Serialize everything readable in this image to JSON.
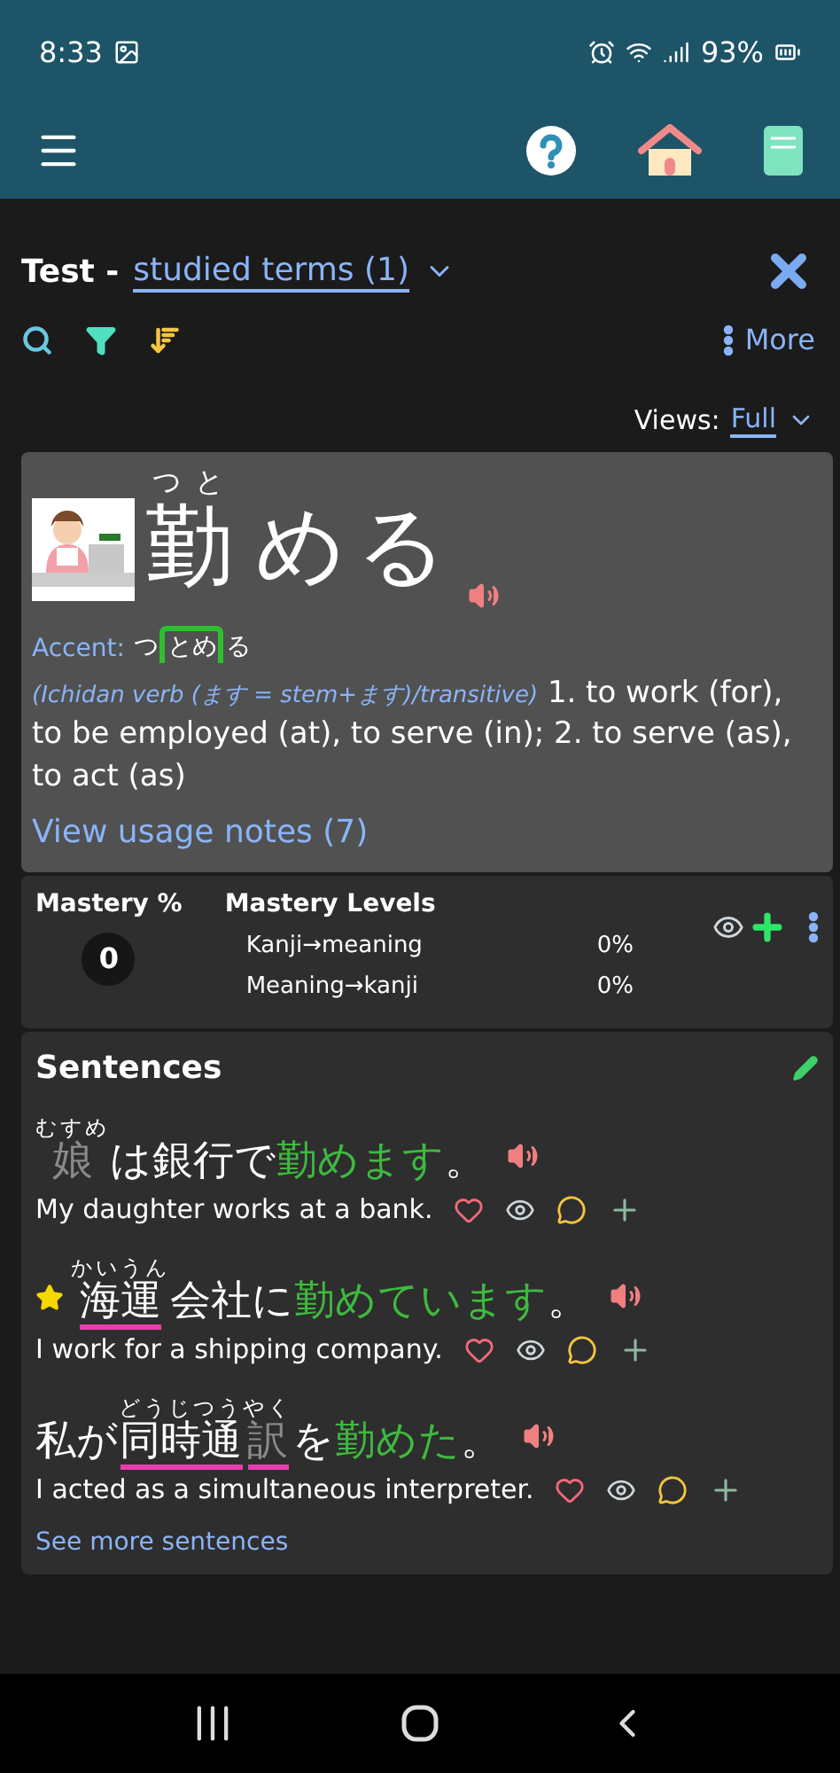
{
  "status_bar": {
    "time": "8:33",
    "battery": "93%"
  },
  "header": {
    "title": "Test -",
    "set": "studied terms (1)",
    "more": "More",
    "views_label": "Views:",
    "views_value": "Full"
  },
  "term": {
    "headword": [
      {
        "text": "勤",
        "ruby": "つと"
      },
      {
        "text": "める"
      }
    ],
    "accent_label": "Accent:",
    "accent": [
      {
        "text": "つ",
        "high": false
      },
      {
        "text": "とめ",
        "high": true
      },
      {
        "text": "る",
        "high": false
      }
    ],
    "pos": "(Ichidan verb (ます = stem+ます)/transitive)",
    "definition": "1. to work (for), to be employed (at), to serve (in); 2. to serve (as), to act (as)",
    "usage_link": "View usage notes (7)"
  },
  "mastery": {
    "title": "Mastery %",
    "value": "0",
    "levels_title": "Mastery Levels",
    "levels": [
      {
        "label": "Kanji→meaning",
        "value": "0%"
      },
      {
        "label": "Meaning→kanji",
        "value": "0%"
      }
    ]
  },
  "sentences": {
    "title": "Sentences",
    "items": [
      {
        "starred": false,
        "segments": [
          {
            "text": "娘",
            "ruby": "むすめ",
            "kind": "faded",
            "underline": false
          },
          {
            "text": "は銀行で",
            "kind": "plain",
            "underline": false
          },
          {
            "text": "勤めます",
            "kind": "target",
            "underline": false
          },
          {
            "text": "。",
            "kind": "plain",
            "underline": false
          }
        ],
        "translation": "My daughter works at a bank."
      },
      {
        "starred": true,
        "segments": [
          {
            "text": "海運",
            "ruby": "かいうん",
            "kind": "plain",
            "underline": true
          },
          {
            "text": "会社に",
            "kind": "plain",
            "underline": false
          },
          {
            "text": "勤めています",
            "kind": "target",
            "underline": false
          },
          {
            "text": "。",
            "kind": "plain",
            "underline": false
          }
        ],
        "translation": "I work for a shipping company."
      },
      {
        "starred": false,
        "segments": [
          {
            "text": "私が",
            "kind": "plain",
            "underline": false
          },
          {
            "text": "同時通",
            "ruby": "どうじつう",
            "kind": "plain",
            "underline": true
          },
          {
            "text": "訳",
            "ruby": "やく",
            "kind": "faded",
            "underline": true
          },
          {
            "text": "を",
            "kind": "plain",
            "underline": false
          },
          {
            "text": "勤めた",
            "kind": "target",
            "underline": false
          },
          {
            "text": "。",
            "kind": "plain",
            "underline": false
          }
        ],
        "translation": "I acted as a simultaneous interpreter."
      }
    ],
    "more_link": "See more sentences"
  }
}
